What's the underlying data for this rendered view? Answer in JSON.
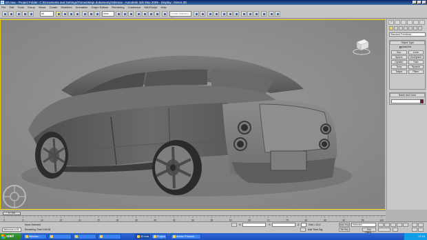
{
  "window": {
    "title": "02.max   -   Project Folder: C:\\Documents and Settings\\Tomas\\Moje dokumenty\\3dsmax   -   Autodesk 3ds Max 2009   -   Display : Direct 3D"
  },
  "menu": [
    "File",
    "Edit",
    "Tools",
    "Group",
    "Views",
    "Create",
    "Modifiers",
    "Animation",
    "Graph Editors",
    "Rendering",
    "Customize",
    "MAXScript",
    "Help"
  ],
  "toolbar": {
    "selection_filter": "All",
    "reference_system": "View",
    "named_selection_placeholder": "Create Selection Se"
  },
  "viewport": {
    "label": "Perspective",
    "border_color": "#e8d000"
  },
  "command_panel": {
    "tabs": [
      "+",
      "",
      "",
      "",
      "",
      ""
    ],
    "category_dropdown": "Standard Primitives",
    "object_type_header": "Object Type",
    "autogrid_label": "AutoGrid",
    "primitive_buttons": [
      "Box",
      "Cone",
      "Sphere",
      "GeoSphere",
      "Cylinder",
      "Tube",
      "Torus",
      "Pyramid",
      "Teapot",
      "Plane"
    ],
    "name_color_header": "Name and Color",
    "swatch_color": "#a00018"
  },
  "timeline": {
    "frame_readout": "0 / 100",
    "ruler_labels": [
      "0",
      "5",
      "10",
      "15",
      "20",
      "25",
      "30",
      "35",
      "40",
      "45",
      "50",
      "55",
      "60",
      "65",
      "70",
      "75",
      "80",
      "85",
      "90",
      "95",
      "100"
    ]
  },
  "status": {
    "maxscript_listener": "Welcome to M",
    "selection_status": "None Selected",
    "render_time": "Rendering Time 0:00:06",
    "x_label": "X:",
    "y_label": "Y:",
    "z_label": "Z:",
    "grid": "Grid = 10,0",
    "add_time_tag": "Add Time Tag",
    "auto_key": "Auto Key",
    "set_key": "Set Key",
    "selected_option": "Selected",
    "key_filters": "Key Filters..."
  },
  "taskbar": {
    "start_label": "start",
    "tasks": [
      "Window...",
      "Adobe Photosh...",
      "",
      "",
      "02.max - Autod...",
      "Project F..."
    ],
    "clock": "17:23"
  }
}
